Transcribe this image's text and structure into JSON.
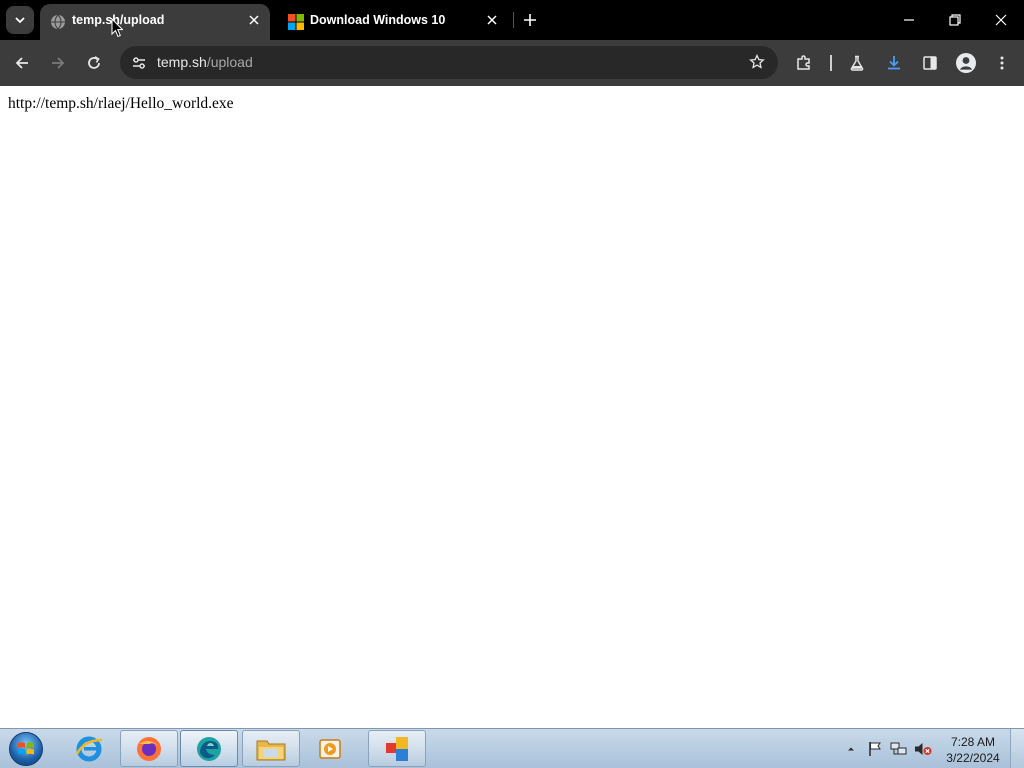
{
  "browser": {
    "tabs": [
      {
        "title": "temp.sh/upload",
        "favicon": "globe-icon",
        "active": true
      },
      {
        "title": "Download Windows 10",
        "favicon": "microsoft-logo-icon",
        "active": false
      }
    ],
    "address_bar": {
      "host": "temp.sh",
      "path": "/upload"
    }
  },
  "page": {
    "body_text": "http://temp.sh/rlaej/Hello_world.exe"
  },
  "taskbar": {
    "pinned": [
      "internet-explorer-icon",
      "firefox-icon",
      "edge-icon",
      "file-explorer-icon",
      "media-player-icon",
      "desktop-tools-icon"
    ],
    "clock": {
      "time": "7:28 AM",
      "date": "3/22/2024"
    }
  },
  "colors": {
    "tabstrip_bg": "#000000",
    "toolbar_bg": "#3c3c3c",
    "omnibox_bg": "#282828",
    "download_accent": "#4a9cf6"
  }
}
